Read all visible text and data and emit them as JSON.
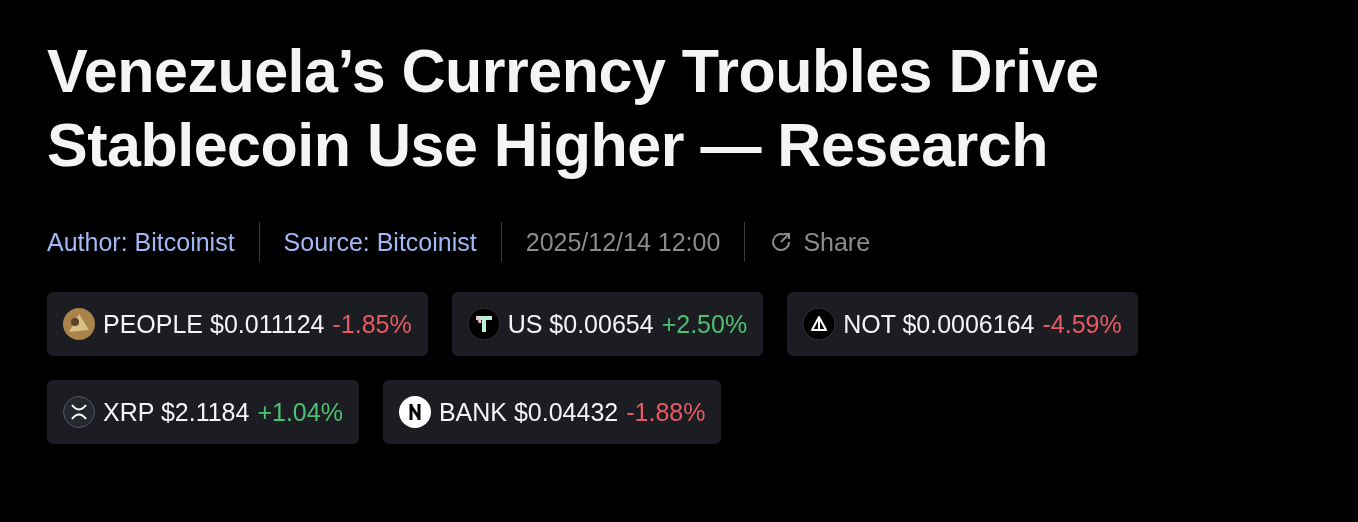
{
  "headline": "Venezuela’s Currency Troubles Drive Stablecoin Use Higher — Research",
  "meta": {
    "author": "Author: Bitcoinist",
    "source": "Source: Bitcoinist",
    "date": "2025/12/14 12:00",
    "share": "Share"
  },
  "tickers": [
    {
      "kind": "people",
      "symbol": "PEOPLE",
      "price": "$0.011124",
      "change": "-1.85%",
      "color": "#e85a63"
    },
    {
      "kind": "us",
      "symbol": "US",
      "price": "$0.00654",
      "change": "+2.50%",
      "color": "#4fbf72"
    },
    {
      "kind": "not",
      "symbol": "NOT",
      "price": "$0.0006164",
      "change": "-4.59%",
      "color": "#e85a63"
    },
    {
      "kind": "xrp",
      "symbol": "XRP",
      "price": "$2.1184",
      "change": "+1.04%",
      "color": "#4fbf72"
    },
    {
      "kind": "bank",
      "symbol": "BANK",
      "price": "$0.04432",
      "change": "-1.88%",
      "color": "#e85a63"
    }
  ]
}
